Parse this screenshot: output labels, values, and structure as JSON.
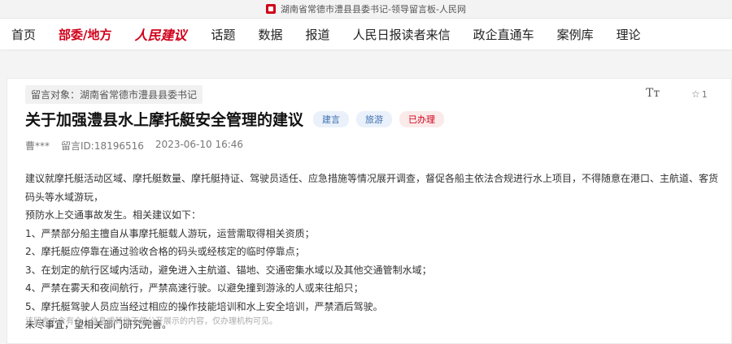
{
  "browser": {
    "tab_title": "湖南省常德市澧县县委书记-领导留言板-人民网",
    "tab_icon": "people-daily-favicon"
  },
  "nav": {
    "items": [
      "首页",
      "部委/地方",
      "人民建议",
      "话题",
      "数据",
      "报道",
      "人民日报读者来信",
      "政企直通车",
      "案例库",
      "理论"
    ],
    "active_index": 1,
    "logo_index": 2
  },
  "message": {
    "target": "留言对象：湖南省常德市澧县县委书记",
    "font_size_icon": "Tт",
    "favorite_count": "1",
    "favorite_icon": "☆",
    "title": "关于加强澧县水上摩托艇安全管理的建议",
    "tags": [
      {
        "label": "建言",
        "color": "#3c6fb0"
      },
      {
        "label": "旅游",
        "color": "#3c6fb0"
      },
      {
        "label": "已办理",
        "color": "#d0021b"
      }
    ],
    "author": "曹***",
    "message_id": "留言ID:18196516",
    "datetime": "2023-06-10 16:46",
    "body": [
      "建议就摩托艇活动区域、摩托艇数量、摩托艇持证、驾驶员适任、应急措施等情况展开调查，督促各船主依法合规进行水上项目，不得随意在港口、主航道、客货码头等水域游玩，",
      "预防水上交通事故发生。相关建议如下：",
      "1、严禁部分船主擅自从事摩托艇载人游玩，运营需取得相关资质；",
      "2、摩托艇应停靠在通过验收合格的码头或经核定的临时停靠点；",
      "3、在划定的航行区域内活动，避免进入主航道、锚地、交通密集水域以及其他交通管制水域；",
      "4、严禁在雾天和夜间航行，严禁高速行驶。以避免撞到游泳的人或来往船只；",
      "5、摩托艇驾驶人员应当经过相应的操作技能培训和水上安全培训，严禁酒后驾驶。",
      "未尽事宜，望相关部门研究完善。"
    ],
    "disclaimer": "该留言中含有个人信息或其他不便公开展示的内容，仅办理机构可见。"
  },
  "colors": {
    "brand_red": "#d0021b",
    "tag_blue": "#3c6fb0"
  }
}
